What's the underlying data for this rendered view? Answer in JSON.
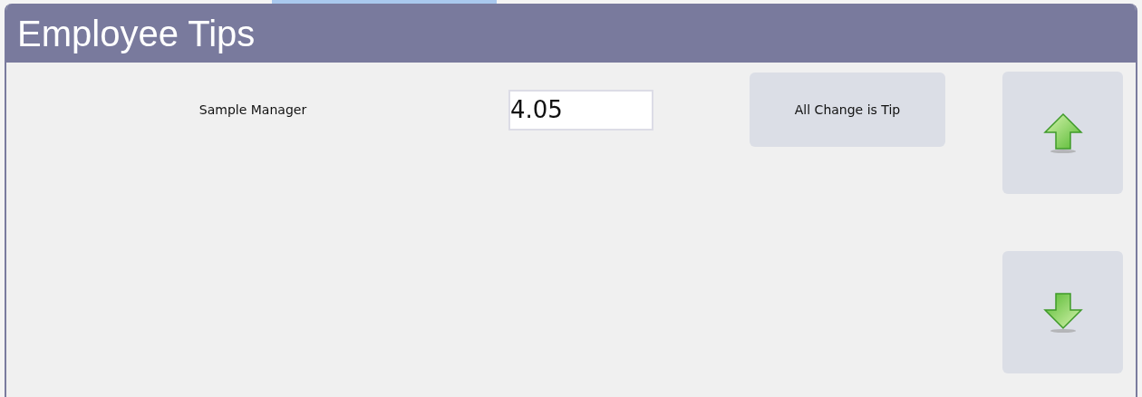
{
  "dialog": {
    "title": "Employee Tips"
  },
  "employees": [
    {
      "name": "Sample Manager",
      "tip": "4.05",
      "action": "All Change is Tip"
    }
  ],
  "scroll_buttons": [
    {
      "kind": "up"
    },
    {
      "kind": "down"
    }
  ]
}
